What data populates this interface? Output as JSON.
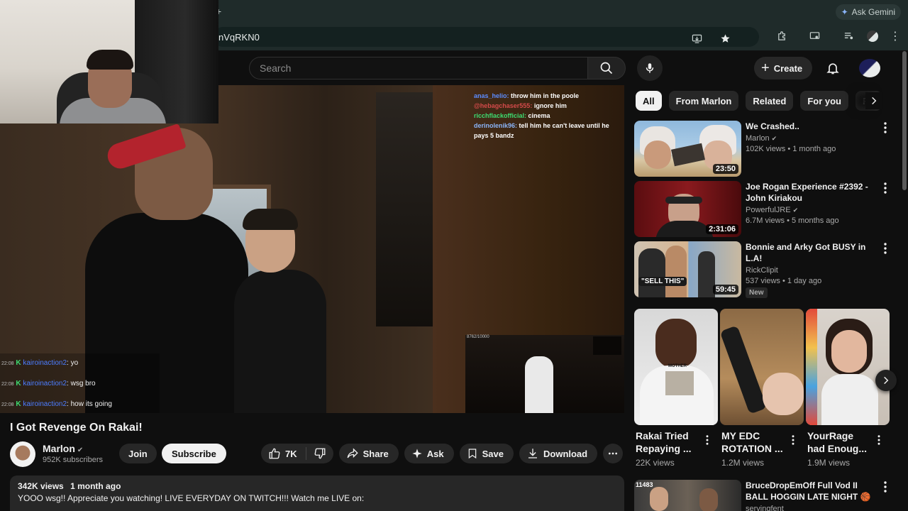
{
  "browser": {
    "tab_symbol": "+",
    "ask_gemini": "Ask Gemini",
    "url": "nVqRKN0"
  },
  "header": {
    "search_placeholder": "Search",
    "create_label": "Create"
  },
  "player": {
    "chat_top": [
      {
        "user": "anas_helio:",
        "message": "throw him in the poole",
        "color": "#5b8cff"
      },
      {
        "user": "@hebagchaser555:",
        "message": "ignore him",
        "color": "#d44a4a"
      },
      {
        "user": "ricchflackofficial:",
        "message": "cinema",
        "color": "#3ddc70"
      },
      {
        "user": "derinolenik96:",
        "message": "tell him he can't leave until he pays 5 bandz",
        "color": "#8ab4f8"
      }
    ],
    "chat_bottom": [
      {
        "time": "22:08",
        "user": "kairoinaction2",
        "message": ": yo"
      },
      {
        "time": "22:08",
        "user": "kairoinaction2",
        "message": ": wsg bro"
      },
      {
        "time": "22:08",
        "user": "kairoinaction2",
        "message": ": how its going"
      }
    ],
    "pip_counter": "8762/10000"
  },
  "video": {
    "title": "I Got Revenge On Rakai!",
    "channel": "Marlon",
    "subscribers": "952K subscribers",
    "join_label": "Join",
    "subscribe_label": "Subscribe",
    "likes": "7K",
    "share_label": "Share",
    "ask_label": "Ask",
    "save_label": "Save",
    "download_label": "Download",
    "views": "342K views",
    "age": "1 month ago",
    "description": "YOOO wsg!! Appreciate you watching! LIVE EVERYDAY ON TWITCH!!! Watch me LIVE on:"
  },
  "chips": [
    "All",
    "From Marlon",
    "Related",
    "For you",
    "Re"
  ],
  "recommendations": [
    {
      "title": "We Crashed..",
      "channel": "Marlon",
      "verified": true,
      "views": "102K views",
      "age": "1 month ago",
      "duration": "23:50",
      "is_new": false
    },
    {
      "title": "Joe Rogan Experience #2392 - John Kiriakou",
      "channel": "PowerfulJRE",
      "verified": true,
      "views": "6.7M views",
      "age": "5 months ago",
      "duration": "2:31:06",
      "is_new": false
    },
    {
      "title": "Bonnie and Arky Got BUSY in L.A!",
      "channel": "RickClipit",
      "verified": false,
      "views": "537 views",
      "age": "1 day ago",
      "duration": "59:45",
      "is_new": true,
      "new_label": "New",
      "thumb_text": "\"SELL THIS\""
    }
  ],
  "shorts": [
    {
      "title": "Rakai Tried Repaying ...",
      "views": "22K views",
      "thumb_text": "MOTHER"
    },
    {
      "title": "MY EDC ROTATION ...",
      "views": "1.2M views"
    },
    {
      "title": "YourRage had Enoug...",
      "views": "1.9M views"
    }
  ],
  "partial_rec": {
    "title": "BruceDropEmOff Full Vod II BALL HOGGIN LATE NIGHT",
    "emoji": "🏀🚀",
    "channel": "servingfent",
    "thumb_count": "11483"
  }
}
